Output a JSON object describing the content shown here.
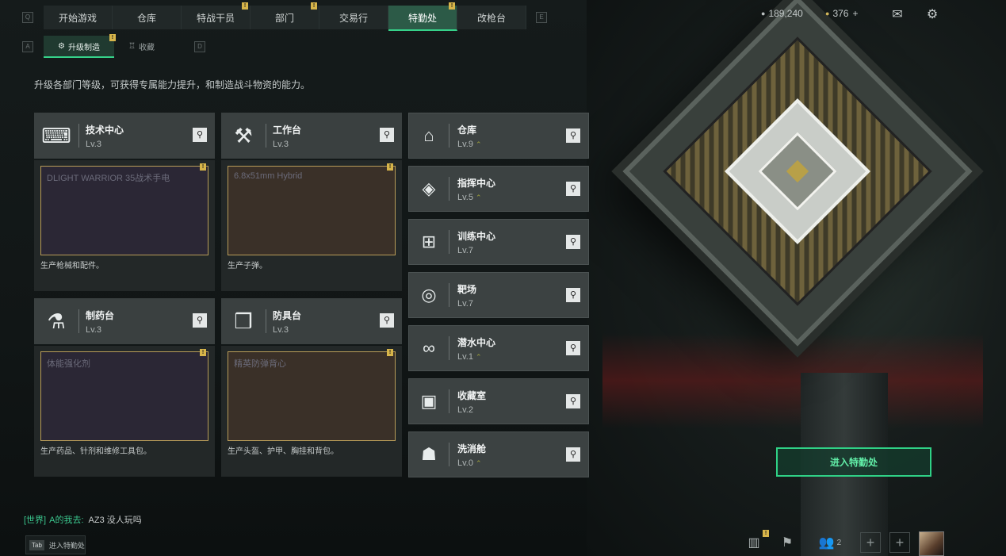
{
  "nav": {
    "tabs": [
      {
        "label": "开始游戏",
        "active": false,
        "badge": ""
      },
      {
        "label": "仓库",
        "active": false,
        "badge": ""
      },
      {
        "label": "特战干员",
        "active": false,
        "badge": "!"
      },
      {
        "label": "部门",
        "active": false,
        "badge": "!"
      },
      {
        "label": "交易行",
        "active": false,
        "badge": ""
      },
      {
        "label": "特勤处",
        "active": true,
        "badge": "!"
      },
      {
        "label": "改枪台",
        "active": false,
        "badge": ""
      }
    ],
    "key_left": "Q",
    "key_right": "E"
  },
  "subtabs": {
    "items": [
      {
        "label": "升级制造",
        "active": true
      },
      {
        "label": "收藏",
        "active": false
      }
    ],
    "key_left": "A",
    "key_right": "D"
  },
  "description": "升级各部门等级，可获得专属能力提升，和制造战斗物资的能力。",
  "production_cards": [
    {
      "name": "技术中心",
      "level": "Lv.3",
      "icon": "computer-icon",
      "item_title": "DLIGHT WARRIOR 35战术手电",
      "blurb": "生产枪械和配件。",
      "badge": "!"
    },
    {
      "name": "工作台",
      "level": "Lv.3",
      "icon": "tools-icon",
      "item_title": "6.8x51mm Hybrid",
      "blurb": "生产子弹。",
      "badge": "!"
    },
    {
      "name": "制药台",
      "level": "Lv.3",
      "icon": "microscope-icon",
      "item_title": "体能强化剂",
      "blurb": "生产药品、针剂和维修工具包。",
      "badge": "!"
    },
    {
      "name": "防具台",
      "level": "Lv.3",
      "icon": "cubes-icon",
      "item_title": "精英防弹背心",
      "blurb": "生产头盔、护甲、胸挂和背包。",
      "badge": "!"
    }
  ],
  "facilities": [
    {
      "name": "仓库",
      "level": "Lv.9",
      "upgradable": true,
      "icon": "warehouse-icon"
    },
    {
      "name": "指挥中心",
      "level": "Lv.5",
      "upgradable": true,
      "icon": "command-icon"
    },
    {
      "name": "训练中心",
      "level": "Lv.7",
      "upgradable": false,
      "icon": "dumbbell-icon"
    },
    {
      "name": "靶场",
      "level": "Lv.7",
      "upgradable": false,
      "icon": "target-icon"
    },
    {
      "name": "潜水中心",
      "level": "Lv.1",
      "upgradable": true,
      "icon": "goggles-icon"
    },
    {
      "name": "收藏室",
      "level": "Lv.2",
      "upgradable": false,
      "icon": "collection-icon"
    },
    {
      "name": "洗消舱",
      "level": "Lv.0",
      "upgradable": true,
      "icon": "decon-icon"
    }
  ],
  "currency": {
    "coins": "189,240",
    "premium": "376",
    "plus": "+"
  },
  "enter_button": "进入特勤处",
  "chat": {
    "channel": "[世界]",
    "sender": "A的我去:",
    "message": "AZ3  没人玩吗"
  },
  "tab_hint": {
    "key": "Tab",
    "label": "进入特勤处"
  },
  "bottom": {
    "friends_count": "2",
    "stats_badge": "!"
  },
  "colors": {
    "accent": "#36d28a",
    "badge": "#d7b54a",
    "card": "#3a4040"
  }
}
